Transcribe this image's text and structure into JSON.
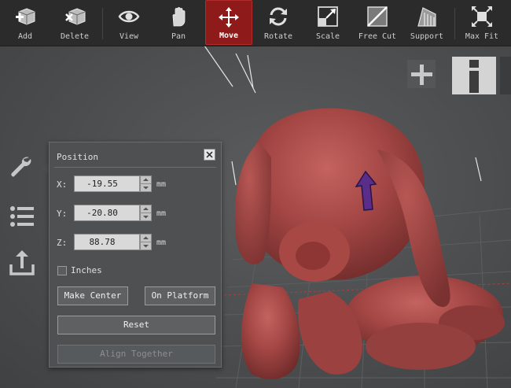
{
  "toolbar": {
    "items": [
      {
        "label": "Add",
        "icon": "add-cube-icon"
      },
      {
        "label": "Delete",
        "icon": "delete-cube-icon"
      },
      {
        "label": "View",
        "icon": "eye-icon"
      },
      {
        "label": "Pan",
        "icon": "hand-icon"
      },
      {
        "label": "Move",
        "icon": "move-arrows-icon",
        "active": true
      },
      {
        "label": "Rotate",
        "icon": "rotate-icon"
      },
      {
        "label": "Scale",
        "icon": "scale-icon"
      },
      {
        "label": "Free Cut",
        "icon": "cut-icon"
      },
      {
        "label": "Support",
        "icon": "support-icon"
      },
      {
        "label": "Max Fit",
        "icon": "max-fit-icon"
      }
    ],
    "active_color": "#8e1a1a"
  },
  "sidebar": {
    "icons": [
      "wrench-icon",
      "list-icon",
      "export-icon"
    ]
  },
  "corner": {
    "icons": [
      "zoom-plus-icon",
      "info-icon"
    ]
  },
  "position_panel": {
    "title": "Position",
    "fields": [
      {
        "label": "X:",
        "value": "-19.55",
        "unit": "mm"
      },
      {
        "label": "Y:",
        "value": "-20.80",
        "unit": "mm"
      },
      {
        "label": "Z:",
        "value": "88.78",
        "unit": "mm"
      }
    ],
    "inches_label": "Inches",
    "inches_checked": false,
    "make_center_label": "Make Center",
    "on_platform_label": "On Platform",
    "reset_label": "Reset",
    "align_together_label": "Align Together"
  },
  "model": {
    "color": "#a34644",
    "arrow_color": "#5a2d8a"
  }
}
